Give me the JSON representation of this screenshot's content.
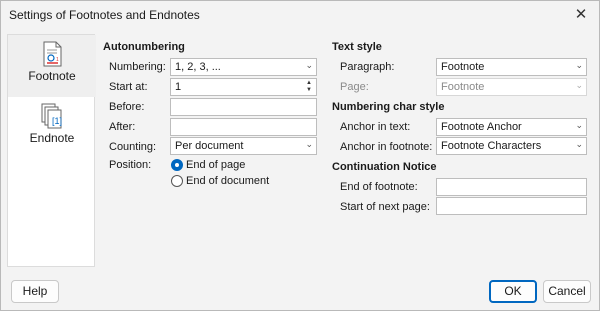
{
  "window": {
    "title": "Settings of Footnotes and Endnotes",
    "close_glyph": "✕"
  },
  "sidebar": {
    "items": [
      {
        "label": "Footnote",
        "icon": "footnote-icon",
        "selected": true
      },
      {
        "label": "Endnote",
        "icon": "endnote-icon",
        "selected": false
      }
    ]
  },
  "autonumbering": {
    "heading": "Autonumbering",
    "numbering_label": "Numbering:",
    "numbering_value": "1, 2, 3, ...",
    "start_label": "Start at:",
    "start_value": "1",
    "before_label": "Before:",
    "before_value": "",
    "after_label": "After:",
    "after_value": "",
    "counting_label": "Counting:",
    "counting_value": "Per document",
    "position_label": "Position:",
    "position_options": [
      {
        "label": "End of page",
        "checked": true
      },
      {
        "label": "End of document",
        "checked": false
      }
    ]
  },
  "text_style": {
    "heading": "Text style",
    "paragraph_label": "Paragraph:",
    "paragraph_value": "Footnote",
    "page_label": "Page:",
    "page_value": "Footnote"
  },
  "numbering_char_style": {
    "heading": "Numbering char style",
    "anchor_text_label": "Anchor in text:",
    "anchor_text_value": "Footnote Anchor",
    "anchor_footnote_label": "Anchor in footnote:",
    "anchor_footnote_value": "Footnote Characters"
  },
  "continuation": {
    "heading": "Continuation Notice",
    "end_label": "End of footnote:",
    "end_value": "",
    "start_label": "Start of next page:",
    "start_value": ""
  },
  "buttons": {
    "help": "Help",
    "ok": "OK",
    "cancel": "Cancel"
  },
  "colors": {
    "accent": "#0067c0",
    "disabled_text": "#8a8a8a"
  }
}
